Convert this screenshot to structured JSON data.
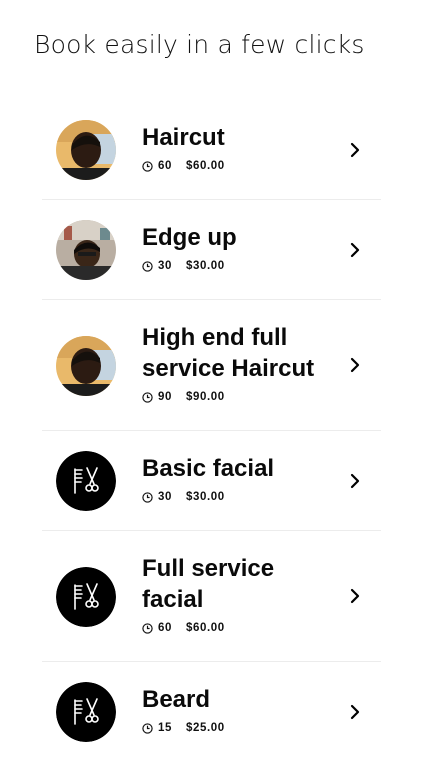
{
  "header": {
    "title": "Book easily in a few clicks"
  },
  "services": [
    {
      "name": "Haircut",
      "duration": "60",
      "price": "$60.00",
      "image": "barber-photo"
    },
    {
      "name": "Edge up",
      "duration": "30",
      "price": "$30.00",
      "image": "haircut-photo"
    },
    {
      "name": "High end full service Haircut",
      "duration": "90",
      "price": "$90.00",
      "image": "barber-photo"
    },
    {
      "name": "Basic facial",
      "duration": "30",
      "price": "$30.00",
      "image": "comb-scissors-icon"
    },
    {
      "name": "Full service facial",
      "duration": "60",
      "price": "$60.00",
      "image": "comb-scissors-icon"
    },
    {
      "name": "Beard",
      "duration": "15",
      "price": "$25.00",
      "image": "comb-scissors-icon"
    }
  ],
  "icons": {
    "duration": "clock-icon",
    "row_action": "chevron-right-icon"
  },
  "colors": {
    "text": "#0a0a0a",
    "divider": "#ececec",
    "icon_circle": "#000000"
  }
}
